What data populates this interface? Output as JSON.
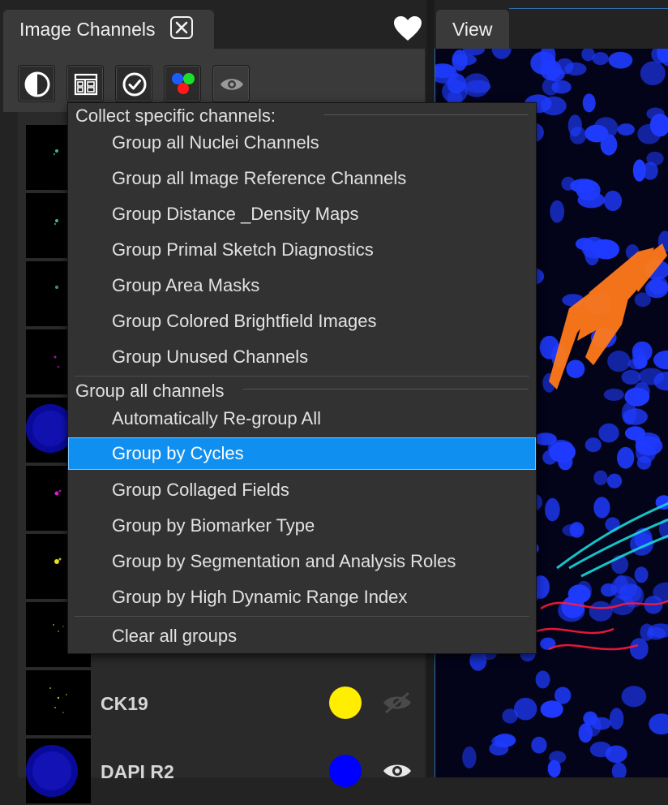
{
  "panel": {
    "title": "Image Channels",
    "toolbar_icons": [
      "contrast-icon",
      "layout-grid-icon",
      "check-circle-icon",
      "rgb-dots-icon",
      "eye-icon"
    ]
  },
  "view": {
    "tab_label": "View"
  },
  "channels": [
    {
      "name": "CK19",
      "color": "#ffee00",
      "visible": false
    },
    {
      "name": "DAPI R2",
      "color": "#0000ff",
      "visible": true
    }
  ],
  "menu": {
    "section1_header": "Collect specific channels:",
    "section1_items": [
      "Group all Nuclei Channels",
      "Group all Image Reference Channels",
      "Group Distance _Density Maps",
      "Group Primal Sketch Diagnostics",
      "Group Area Masks",
      "Group Colored Brightfield Images",
      "Group Unused Channels"
    ],
    "section2_header": "Group all channels",
    "section2_items": [
      "Automatically Re-group All",
      "Group by Cycles",
      "Group Collaged Fields",
      "Group by Biomarker Type",
      "Group by Segmentation and Analysis Roles",
      "Group by High Dynamic Range Index"
    ],
    "selected_item": "Group by Cycles",
    "footer_item": "Clear all groups"
  },
  "colors": {
    "highlight": "#0f8ff0",
    "accent_border": "#2e6fb0"
  }
}
